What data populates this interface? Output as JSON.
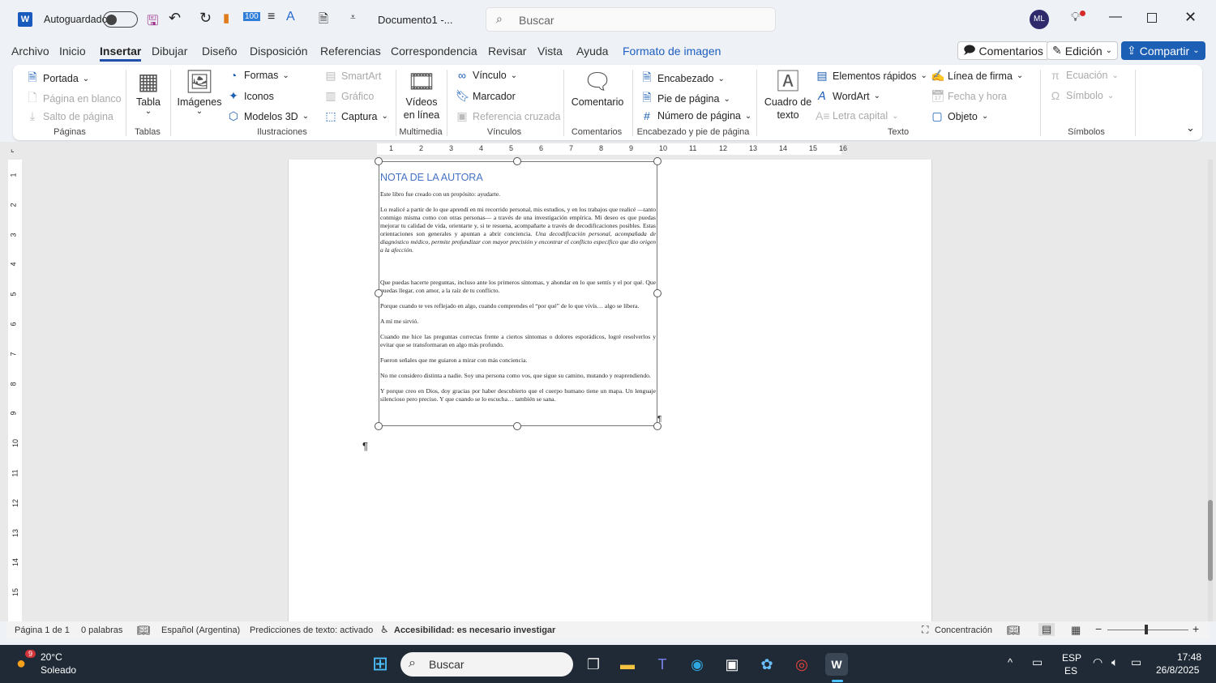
{
  "titlebar": {
    "autosave_label": "Autoguardado",
    "doc_title": "Documento1  -...",
    "search_placeholder": "Buscar",
    "avatar": "ML"
  },
  "tabs": [
    "Archivo",
    "Inicio",
    "Insertar",
    "Dibujar",
    "Diseño",
    "Disposición",
    "Referencias",
    "Correspondencia",
    "Revisar",
    "Vista",
    "Ayuda",
    "Formato de imagen"
  ],
  "actions": {
    "comments": "Comentarios",
    "editing": "Edición",
    "share": "Compartir"
  },
  "ribbon": {
    "paginas": {
      "label": "Páginas",
      "portada": "Portada",
      "blank": "Página en blanco",
      "break": "Salto de página"
    },
    "tablas": {
      "label": "Tablas",
      "tabla": "Tabla"
    },
    "ilustraciones": {
      "label": "Ilustraciones",
      "imagenes": "Imágenes",
      "formas": "Formas",
      "iconos": "Iconos",
      "modelos": "Modelos 3D",
      "smartart": "SmartArt",
      "grafico": "Gráfico",
      "captura": "Captura"
    },
    "multimedia": {
      "label": "Multimedia",
      "videos1": "Vídeos",
      "videos2": "en línea"
    },
    "vinculos": {
      "label": "Vínculos",
      "vinculo": "Vínculo",
      "marcador": "Marcador",
      "ref": "Referencia cruzada"
    },
    "comentarios": {
      "label": "Comentarios",
      "comentario": "Comentario"
    },
    "encabezado": {
      "label": "Encabezado y pie de página",
      "enc": "Encabezado",
      "pie": "Pie de página",
      "num": "Número de página"
    },
    "texto": {
      "label": "Texto",
      "cuadro1": "Cuadro de",
      "cuadro2": "texto",
      "elementos": "Elementos rápidos",
      "wordart": "WordArt",
      "letra": "Letra capital",
      "firma": "Línea de firma",
      "fecha": "Fecha y hora",
      "objeto": "Objeto"
    },
    "simbolos": {
      "label": "Símbolos",
      "ecuacion": "Ecuación",
      "simbolo": "Símbolo"
    }
  },
  "ruler": {
    "h": [
      "1",
      "2",
      "3",
      "4",
      "5",
      "6",
      "7",
      "8",
      "9",
      "10",
      "11",
      "12",
      "13",
      "14",
      "15",
      "16"
    ],
    "v": [
      "1",
      "2",
      "3",
      "4",
      "5",
      "6",
      "7",
      "8",
      "9",
      "10",
      "11",
      "12",
      "13",
      "14",
      "15"
    ]
  },
  "document": {
    "title": "NOTA DE LA AUTORA",
    "paragraphs": [
      "Este libro fue creado con un propósito: ayudarte.",
      "Lo realicé a partir de lo que aprendí en mi recorrido personal, mis estudios, y en los trabajos que realicé —tanto conmigo misma como con otras personas— a través de una investigación empírica. Mi deseo es que puedas mejorar tu calidad de vida, orientarte y, si te resuena, acompañarte a través de decodificaciones posibles. Estas orientaciones son generales y apuntan a abrir conciencia.",
      "Una decodificación personal, acompañada de diagnóstico médico, permite profundizar con mayor precisión y encontrar el conflicto específico que dio origen a la afección.",
      "Que puedas hacerte preguntas, incluso ante los primeros síntomas, y ahondar en lo que sentís y el por qué. Que puedas llegar, con amor, a la raíz de tu conflicto.",
      "Porque cuando te ves reflejado en algo, cuando comprendes el “por qué” de lo que vivís… algo se libera.",
      "A mí me sirvió.",
      "Cuando me hice las preguntas correctas frente a ciertos síntomas o dolores esporádicos, logré resolverlos y evitar que se transformaran en algo más profundo.",
      "Fueron señales que me guiaron a mirar con más conciencia.",
      "No me considero distinta a nadie. Soy una persona como vos, que sigue su camino, mutando y reaprendiendo.",
      "Y porque creo en Dios, doy gracias por haber descubierto que el cuerpo humano tiene un mapa. Un lenguaje silencioso pero preciso. Y que cuando se lo escucha… también se sana."
    ],
    "pilcrow": "¶"
  },
  "status": {
    "page": "Página 1 de 1",
    "words": "0 palabras",
    "lang": "Español (Argentina)",
    "pred": "Predicciones de texto: activado",
    "access": "Accesibilidad: es necesario investigar",
    "focus": "Concentración"
  },
  "taskbar": {
    "temp": "20°C",
    "weather": "Soleado",
    "badge": "9",
    "search": "Buscar",
    "lang1": "ESP",
    "lang2": "ES",
    "time": "17:48",
    "date": "26/8/2025"
  },
  "colors": {
    "accent": "#1f5fbf",
    "share": "#1c5fb5",
    "taskbar": "#1f2a36"
  }
}
